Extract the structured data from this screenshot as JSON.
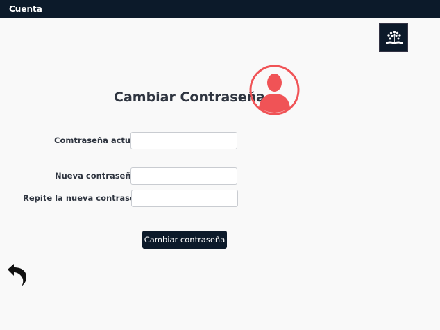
{
  "header": {
    "title": "Cuenta"
  },
  "logo": {
    "icon": "open-book-tree-logo",
    "color": "#ffffff",
    "background": "#0c1a2a"
  },
  "form": {
    "title": "Cambiar Contraseña",
    "avatar": {
      "icon": "user-avatar-icon",
      "color": "#f05356"
    },
    "fields": [
      {
        "label": "Comtraseña actual:",
        "value": "",
        "placeholder": ""
      },
      {
        "label": "Nueva contraseña:",
        "value": "",
        "placeholder": ""
      },
      {
        "label": "Repite la nueva contraseña:",
        "value": "",
        "placeholder": ""
      }
    ],
    "submit_label": "Cambiar contraseña"
  },
  "back": {
    "icon": "back-arrow-icon"
  }
}
